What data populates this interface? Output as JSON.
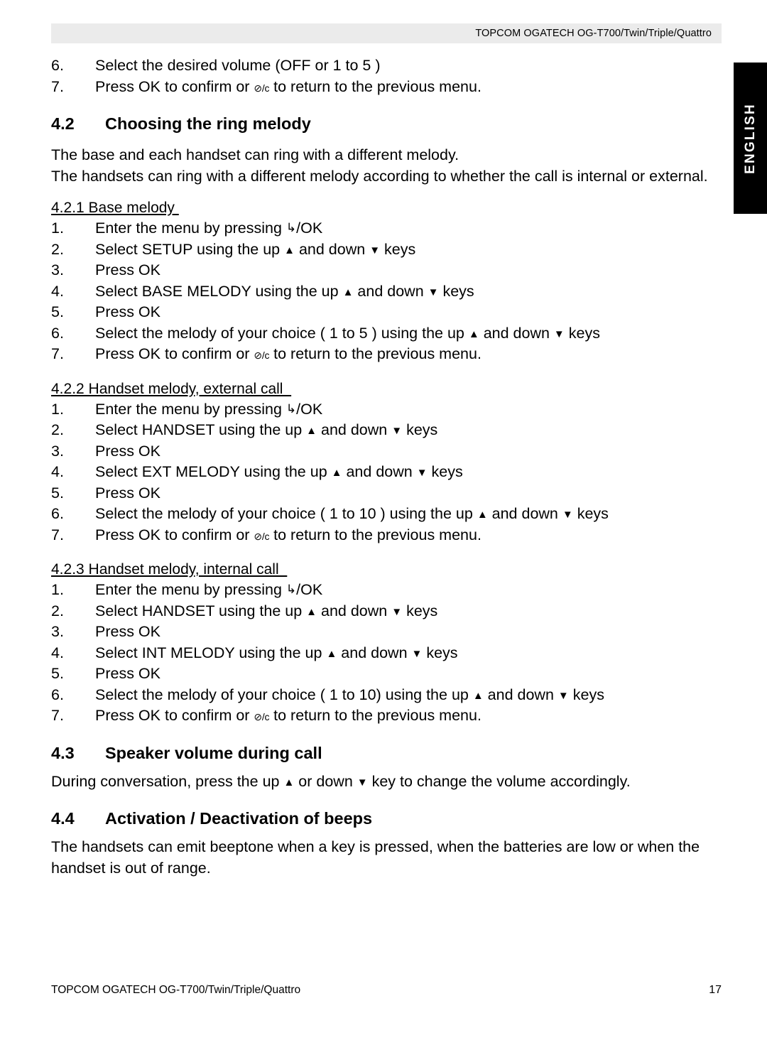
{
  "header": {
    "title": "TOPCOM OGATECH OG-T700/Twin/Triple/Quattro"
  },
  "language_tab": {
    "label": "ENGLISH",
    "background_color": "#000000",
    "text_color": "#ffffff"
  },
  "icons": {
    "up_arrow": "▲",
    "down_arrow": "▼",
    "menu_key": "↳",
    "clear_key": "⊘/c"
  },
  "continued_list": {
    "items": [
      {
        "num": "6.",
        "text": "Select the desired volume (OFF or 1 to 5 )"
      },
      {
        "num": "7.",
        "text_before": "Press OK to confirm or ",
        "icon": "clear_key",
        "text_after": " to return to the previous menu."
      }
    ]
  },
  "section_4_2": {
    "number": "4.2",
    "title": "Choosing the ring melody",
    "paragraphs": [
      "The base and each handset can ring with a different melody.",
      "The handsets can ring with a different melody according to whether the call is internal or external."
    ],
    "subsections": [
      {
        "heading": "4.2.1 Base melody ",
        "steps": [
          {
            "num": "1.",
            "text_before": "Enter the menu by pressing ",
            "icon": "menu_key",
            "text_after": "/OK"
          },
          {
            "num": "2.",
            "text_before": "Select SETUP using the up ",
            "icon": "up_arrow",
            "text_mid": " and down ",
            "icon2": "down_arrow",
            "text_after": " keys"
          },
          {
            "num": "3.",
            "text": "Press OK"
          },
          {
            "num": "4.",
            "text_before": "Select BASE MELODY using the up ",
            "icon": "up_arrow",
            "text_mid": " and down ",
            "icon2": "down_arrow",
            "text_after": " keys"
          },
          {
            "num": "5.",
            "text": "Press OK"
          },
          {
            "num": "6.",
            "text_before": "Select the melody of your choice ( 1 to 5 ) using the up ",
            "icon": "up_arrow",
            "text_mid": " and down ",
            "icon2": "down_arrow",
            "text_after": " keys"
          },
          {
            "num": "7.",
            "text_before": "Press OK to confirm or ",
            "icon": "clear_key",
            "text_after": " to return to the previous menu."
          }
        ]
      },
      {
        "heading": "4.2.2 Handset melody, external call  ",
        "steps": [
          {
            "num": "1.",
            "text_before": "Enter the menu by pressing ",
            "icon": "menu_key",
            "text_after": "/OK"
          },
          {
            "num": "2.",
            "text_before": "Select HANDSET using the up ",
            "icon": "up_arrow",
            "text_mid": " and down ",
            "icon2": "down_arrow",
            "text_after": " keys"
          },
          {
            "num": "3.",
            "text": "Press OK"
          },
          {
            "num": "4.",
            "text_before": "Select EXT MELODY using the up ",
            "icon": "up_arrow",
            "text_mid": " and down ",
            "icon2": "down_arrow",
            "text_after": " keys"
          },
          {
            "num": "5.",
            "text": "Press OK"
          },
          {
            "num": "6.",
            "text_before": "Select the melody of your choice ( 1 to 10 ) using the up ",
            "icon": "up_arrow",
            "text_mid": " and down ",
            "icon2": "down_arrow",
            "text_after": " keys"
          },
          {
            "num": "7.",
            "text_before": "Press OK to confirm or ",
            "icon": "clear_key",
            "text_after": " to return to the previous menu."
          }
        ]
      },
      {
        "heading": "4.2.3 Handset melody, internal call  ",
        "steps": [
          {
            "num": "1.",
            "text_before": "Enter the menu by pressing ",
            "icon": "menu_key",
            "text_after": "/OK"
          },
          {
            "num": "2.",
            "text_before": "Select HANDSET using the up ",
            "icon": "up_arrow",
            "text_mid": " and down ",
            "icon2": "down_arrow",
            "text_after": " keys"
          },
          {
            "num": "3.",
            "text": "Press OK"
          },
          {
            "num": "4.",
            "text_before": "Select INT MELODY using the up ",
            "icon": "up_arrow",
            "text_mid": " and down ",
            "icon2": "down_arrow",
            "text_after": " keys"
          },
          {
            "num": "5.",
            "text": "Press OK"
          },
          {
            "num": "6.",
            "text_before": "Select the melody of your choice ( 1 to 10) using the up ",
            "icon": "up_arrow",
            "text_mid": " and down ",
            "icon2": "down_arrow",
            "text_after": " keys"
          },
          {
            "num": "7.",
            "text_before": "Press OK to confirm or ",
            "icon": "clear_key",
            "text_after": " to return to the previous menu."
          }
        ]
      }
    ]
  },
  "section_4_3": {
    "number": "4.3",
    "title": "Speaker volume during call",
    "paragraph_before": "During conversation, press the up ",
    "paragraph_mid": " or down ",
    "paragraph_after": " key to change the volume accordingly."
  },
  "section_4_4": {
    "number": "4.4",
    "title": "Activation / Deactivation of beeps",
    "paragraph": "The handsets can emit beeptone when a key is pressed, when the batteries are low or when the handset is out of range."
  },
  "footer": {
    "left": "TOPCOM OGATECH OG-T700/Twin/Triple/Quattro",
    "page_number": "17"
  }
}
